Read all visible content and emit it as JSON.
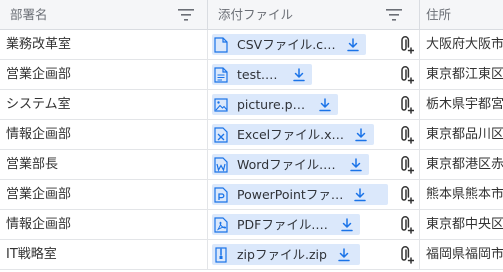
{
  "header": {
    "col_department": "部署名",
    "col_attachment": "添付ファイル",
    "col_address": "住所"
  },
  "rows": [
    {
      "department": "業務改革室",
      "file": "CSVファイル.csv",
      "file_icon": "csv-file-icon",
      "address": "大阪府大阪市"
    },
    {
      "department": "営業企画部",
      "file": "test.txt",
      "file_icon": "text-file-icon",
      "address": "東京都江東区"
    },
    {
      "department": "システム室",
      "file": "picture.png",
      "file_icon": "image-file-icon",
      "address": "栃木県宇都宮"
    },
    {
      "department": "情報企画部",
      "file": "Excelファイル.xlsx",
      "file_icon": "excel-file-icon",
      "address": "東京都品川区"
    },
    {
      "department": "営業部長",
      "file": "Wordファイル.docx",
      "file_icon": "word-file-icon",
      "address": "東京都港区赤"
    },
    {
      "department": "営業企画部",
      "file": "PowerPointファ…",
      "file_icon": "powerpoint-file-icon",
      "address": "熊本県熊本市"
    },
    {
      "department": "情報企画部",
      "file": "PDFファイル.pdf",
      "file_icon": "pdf-file-icon",
      "address": "東京都中央区"
    },
    {
      "department": "IT戦略室",
      "file": "zipファイル.zip",
      "file_icon": "zip-file-icon",
      "address": "福岡県福岡市"
    }
  ],
  "colors": {
    "chip_bg": "#dbe8fb",
    "accent": "#1a73e8",
    "header_bg": "#f5f6f8"
  }
}
